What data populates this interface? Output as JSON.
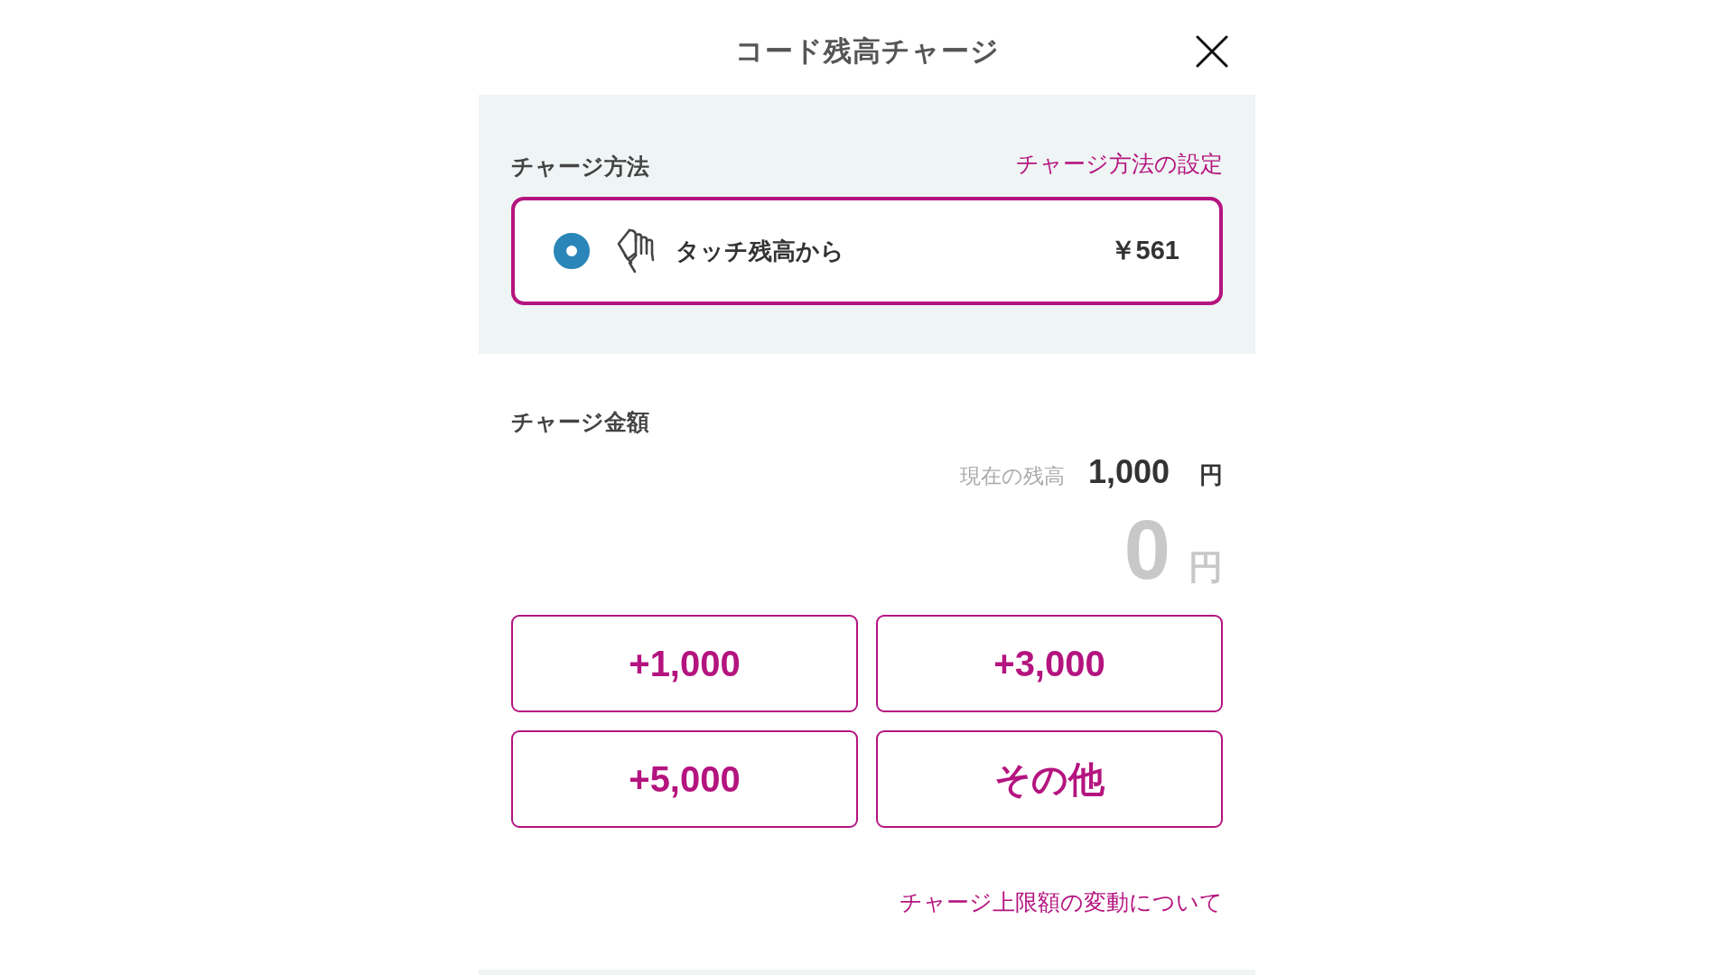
{
  "header": {
    "title": "コード残高チャージ"
  },
  "charge_method": {
    "heading": "チャージ方法",
    "settings_link": "チャージ方法の設定",
    "options": [
      {
        "label": "タッチ残高から",
        "amount": "￥561",
        "selected": true
      }
    ]
  },
  "charge_amount": {
    "heading": "チャージ金額",
    "current_balance": {
      "label": "現在の残高",
      "value": "1,000",
      "unit": "円"
    },
    "entered": {
      "value": "0",
      "unit": "円"
    },
    "quick_buttons": [
      "+1,000",
      "+3,000",
      "+5,000",
      "その他"
    ]
  },
  "limit_link": "チャージ上限額の変動について"
}
